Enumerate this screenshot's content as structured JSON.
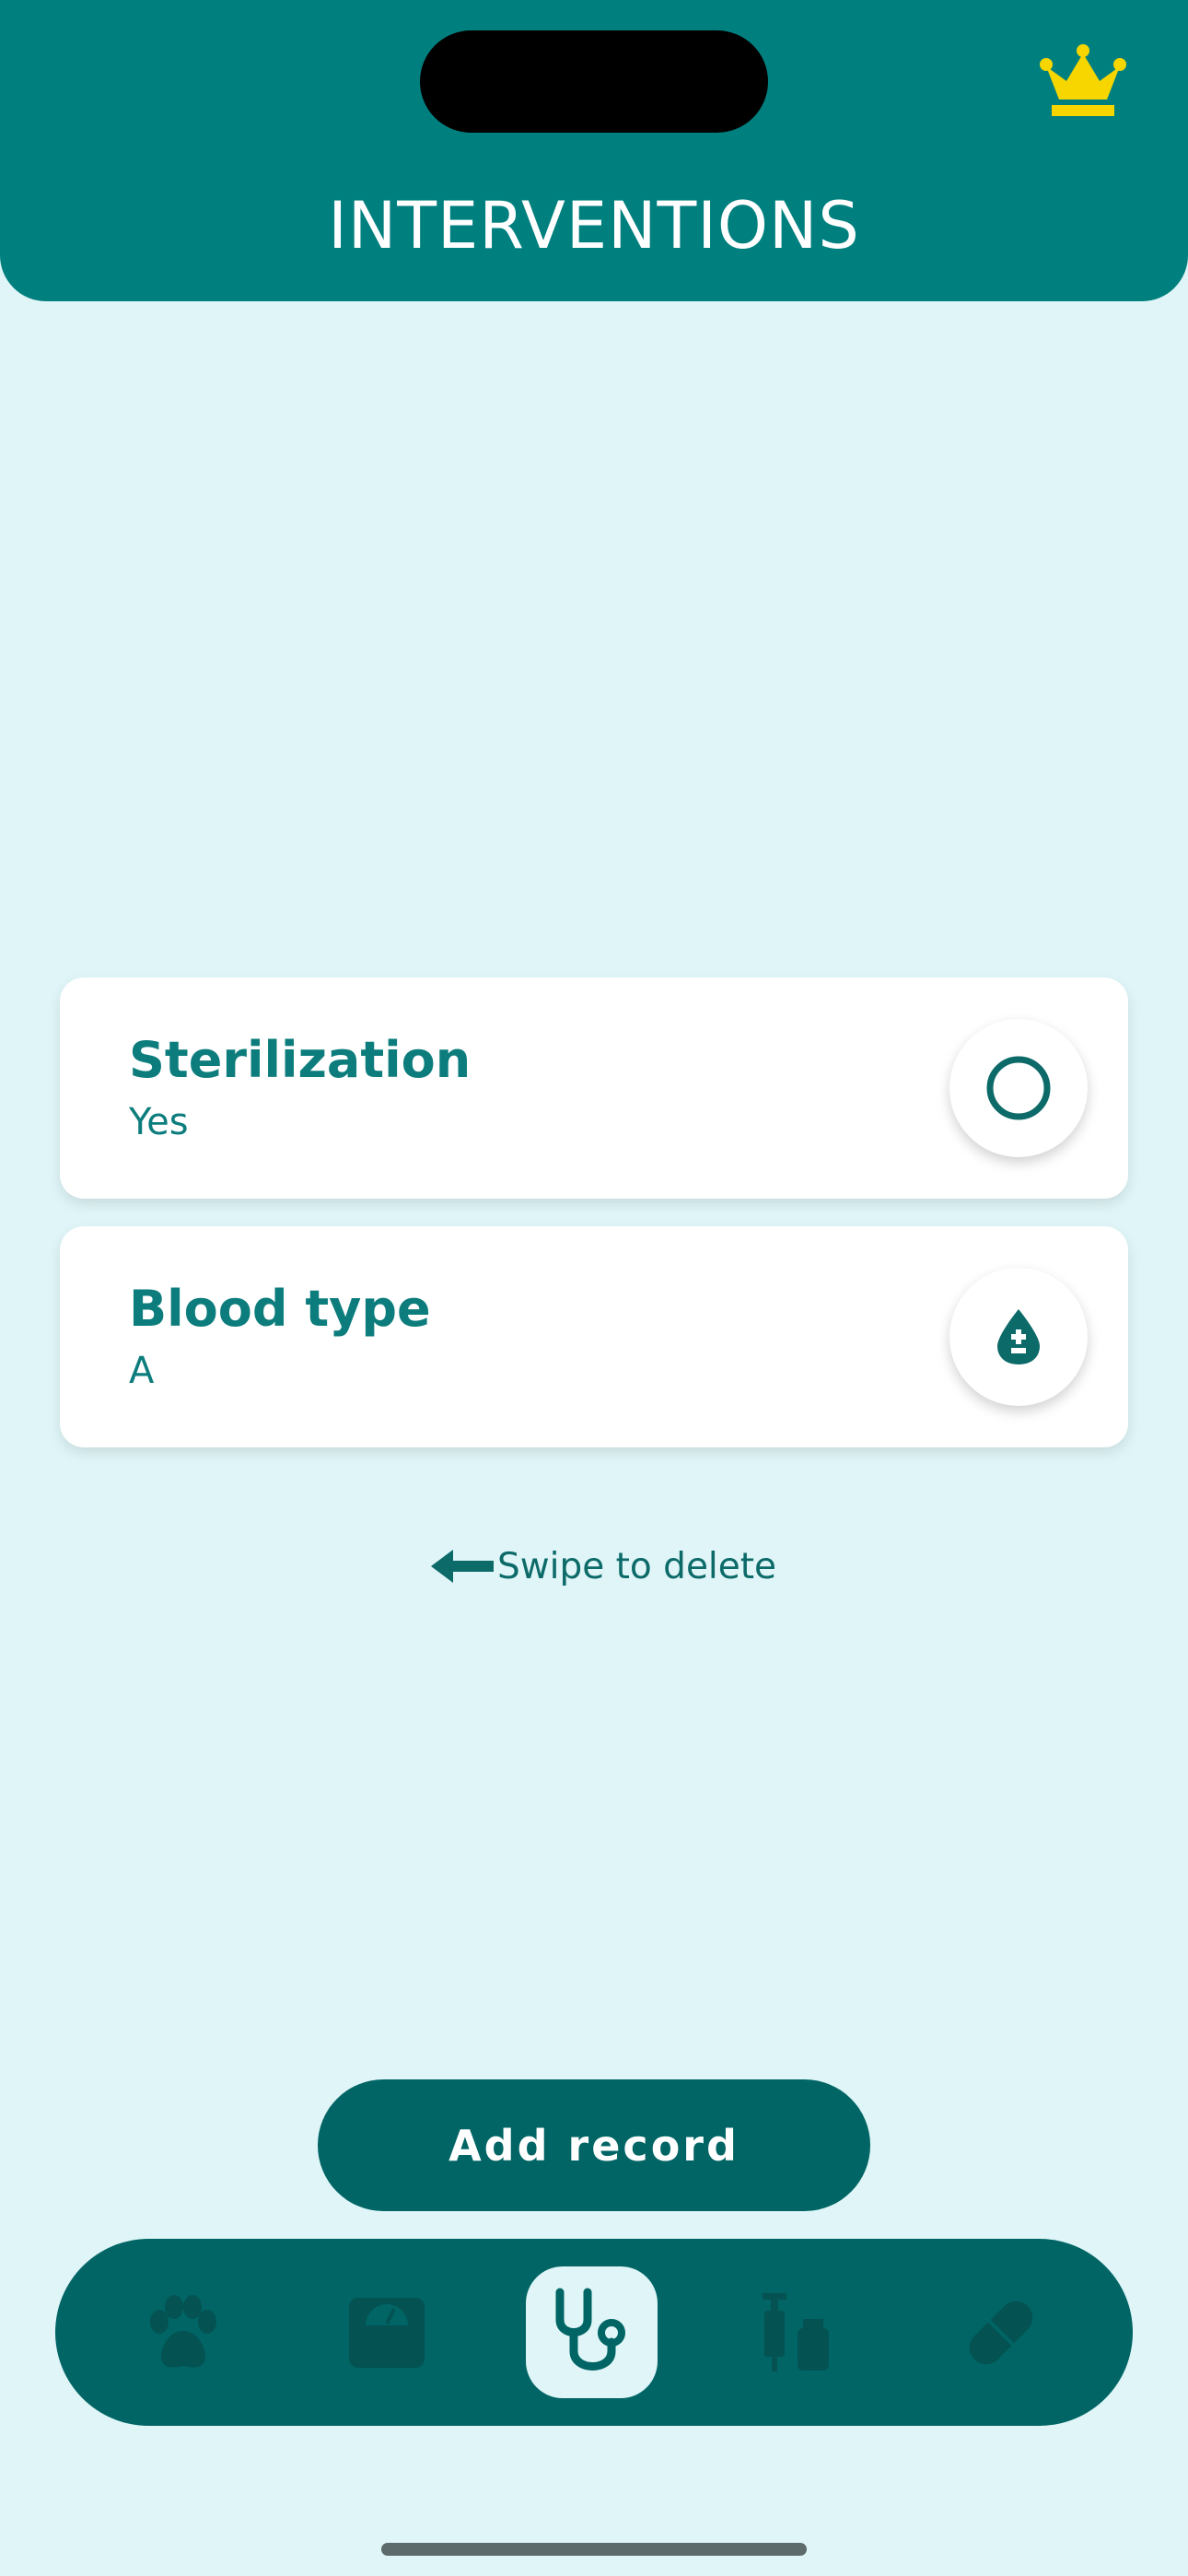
{
  "header": {
    "title": "INTERVENTIONS",
    "premium_icon": "crown-icon",
    "premium_color": "#f7d600"
  },
  "records": [
    {
      "title": "Sterilization",
      "value": "Yes",
      "icon": "circle-outline-icon"
    },
    {
      "title": "Blood type",
      "value": "A",
      "icon": "blood-drop-icon"
    }
  ],
  "hint": {
    "text": "Swipe to delete",
    "icon": "arrow-left-icon"
  },
  "actions": {
    "add_label": "Add record"
  },
  "tabbar": {
    "tabs": [
      {
        "name": "paw-icon",
        "active": false
      },
      {
        "name": "scale-icon",
        "active": false
      },
      {
        "name": "stethoscope-icon",
        "active": true
      },
      {
        "name": "syringe-vial-icon",
        "active": false
      },
      {
        "name": "pill-icon",
        "active": false
      }
    ]
  },
  "colors": {
    "primary": "#007f7f",
    "dark": "#016565",
    "background": "#dff5f7",
    "text": "#0c7d7c"
  }
}
